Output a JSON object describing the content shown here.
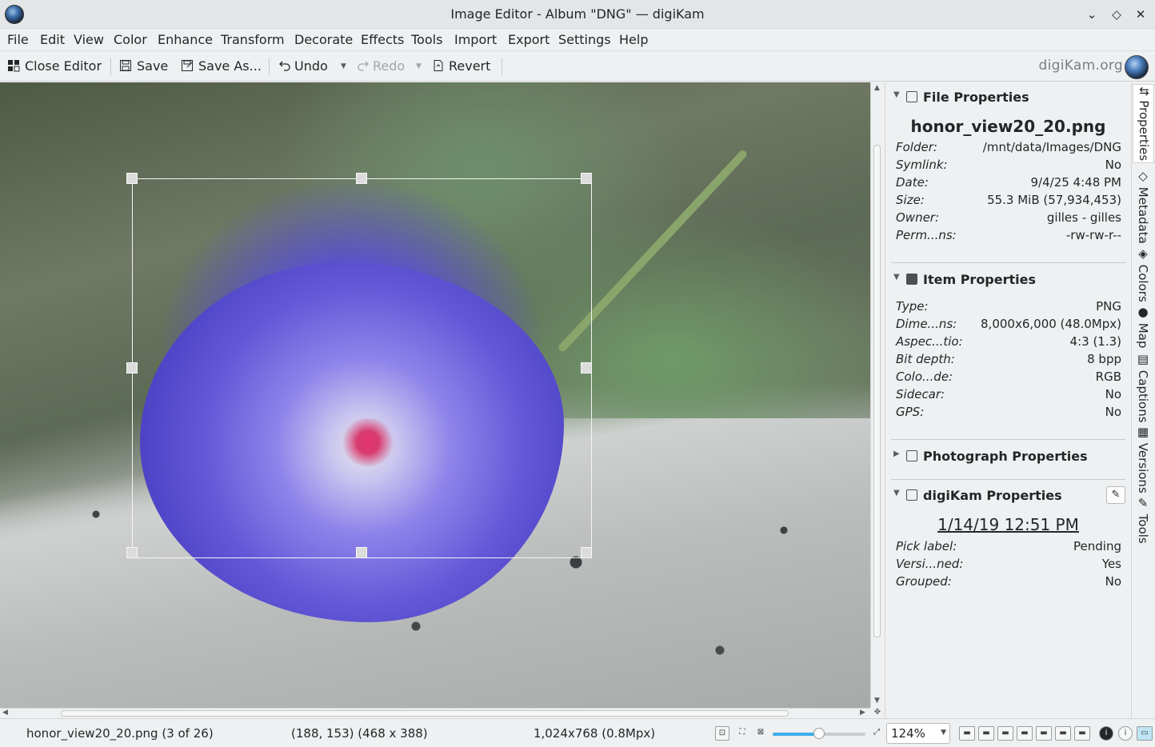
{
  "window": {
    "title": "Image Editor - Album \"DNG\" — digiKam"
  },
  "menu": [
    "File",
    "Edit",
    "View",
    "Color",
    "Enhance",
    "Transform",
    "Decorate",
    "Effects",
    "Tools",
    "Import",
    "Export",
    "Settings",
    "Help"
  ],
  "toolbar": {
    "close_editor": "Close Editor",
    "save": "Save",
    "save_as": "Save As...",
    "undo": "Undo",
    "redo": "Redo",
    "revert": "Revert",
    "brand": "digiKam.org"
  },
  "file_properties": {
    "header": "File Properties",
    "filename": "honor_view20_20.png",
    "rows": [
      {
        "k": "Folder:",
        "v": "/mnt/data/Images/DNG"
      },
      {
        "k": "Symlink:",
        "v": "No"
      },
      {
        "k": "Date:",
        "v": "9/4/25 4:48 PM"
      },
      {
        "k": "Size:",
        "v": "55.3 MiB (57,934,453)"
      },
      {
        "k": "Owner:",
        "v": "gilles - gilles"
      },
      {
        "k": "Perm...ns:",
        "v": "-rw-rw-r--"
      }
    ]
  },
  "item_properties": {
    "header": "Item Properties",
    "rows": [
      {
        "k": "Type:",
        "v": "PNG"
      },
      {
        "k": "Dime...ns:",
        "v": "8,000x6,000 (48.0Mpx)"
      },
      {
        "k": "Aspec...tio:",
        "v": "4:3 (1.3)"
      },
      {
        "k": "Bit depth:",
        "v": "8 bpp"
      },
      {
        "k": "Colo...de:",
        "v": "RGB"
      },
      {
        "k": "Sidecar:",
        "v": "No"
      },
      {
        "k": "GPS:",
        "v": "No"
      }
    ]
  },
  "photograph_properties": {
    "header": "Photograph Properties"
  },
  "digikam_properties": {
    "header": "digiKam Properties",
    "date": "1/14/19 12:51 PM",
    "rows": [
      {
        "k": "Pick label:",
        "v": "Pending"
      },
      {
        "k": "Versi...ned:",
        "v": "Yes"
      },
      {
        "k": "Grouped:",
        "v": "No"
      }
    ]
  },
  "side_tabs": [
    "Properties",
    "Metadata",
    "Colors",
    "Map",
    "Captions",
    "Versions",
    "Tools"
  ],
  "status": {
    "file": "honor_view20_20.png (3 of 26)",
    "selection": "(188, 153) (468 x 388)",
    "image_size": "1,024x768 (0.8Mpx)",
    "zoom": "124%",
    "zoom_slider_fraction": 0.5
  },
  "colors": {
    "accent": "#3daee9"
  }
}
